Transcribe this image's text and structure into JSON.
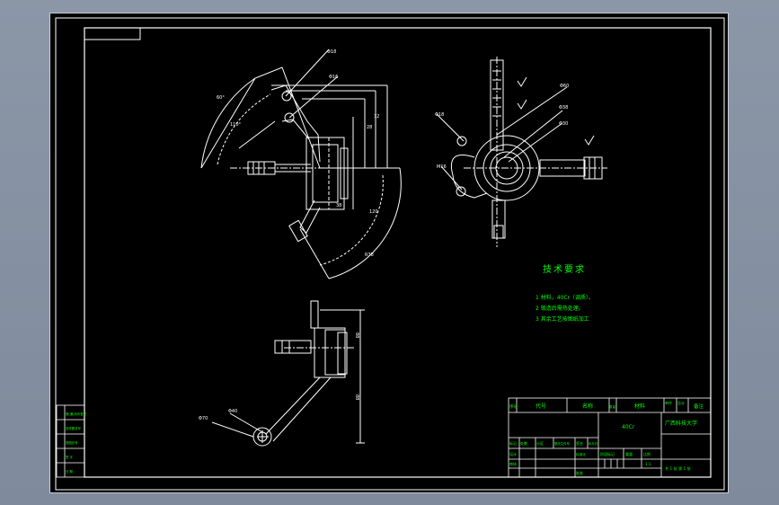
{
  "colors": {
    "viewport_bg": "#8a96a6",
    "paper": "#000000",
    "frame": "#ffffff",
    "geometry": "#ffffff",
    "dimension": "#ffffff",
    "title_text": "#00ff00",
    "table_lines": "#ffffff"
  },
  "tech_requirements": {
    "heading": "技术要求",
    "items": [
      "1 材料，40Cr（调质）。",
      "2 锻造后需热处理。",
      "3 其余工艺按图纸加工"
    ]
  },
  "title_block": {
    "header": {
      "col1": "序号",
      "col2": "代号",
      "col3": "名称",
      "col4": "数量",
      "col5": "材料",
      "col6": "单件",
      "col7": "总计",
      "col8": "备注"
    },
    "material": "40Cr",
    "school": "广西科技大学",
    "rows": {
      "mark": "标记",
      "count": "处数",
      "zone": "分区",
      "change_doc": "更改文件号",
      "sign": "签名",
      "date": "年月日",
      "design": "设计",
      "standardize": "标准化",
      "review": "审核",
      "approve": "批准",
      "stage_mark": "阶段标记",
      "weight": "重量",
      "scale": "比例",
      "scale_value": "1:1",
      "sheet_info": "共 1 张 第 1 张"
    }
  },
  "side_table": {
    "rows": [
      "借(通)用件登记",
      "旧底图总号",
      "底图总号",
      "签  字",
      "日  期"
    ]
  },
  "dims": {
    "front": [
      "Φ18",
      "Φ16",
      "28",
      "32",
      "120",
      "38",
      "36",
      "32",
      "110°",
      "R38",
      "60°"
    ],
    "side": [
      "Φ60",
      "Φ38",
      "Φ30",
      "Φ18",
      "M16",
      "Φ60",
      "Φ20"
    ],
    "bottom": [
      "Φ70",
      "Φ40",
      "88",
      "88"
    ]
  }
}
